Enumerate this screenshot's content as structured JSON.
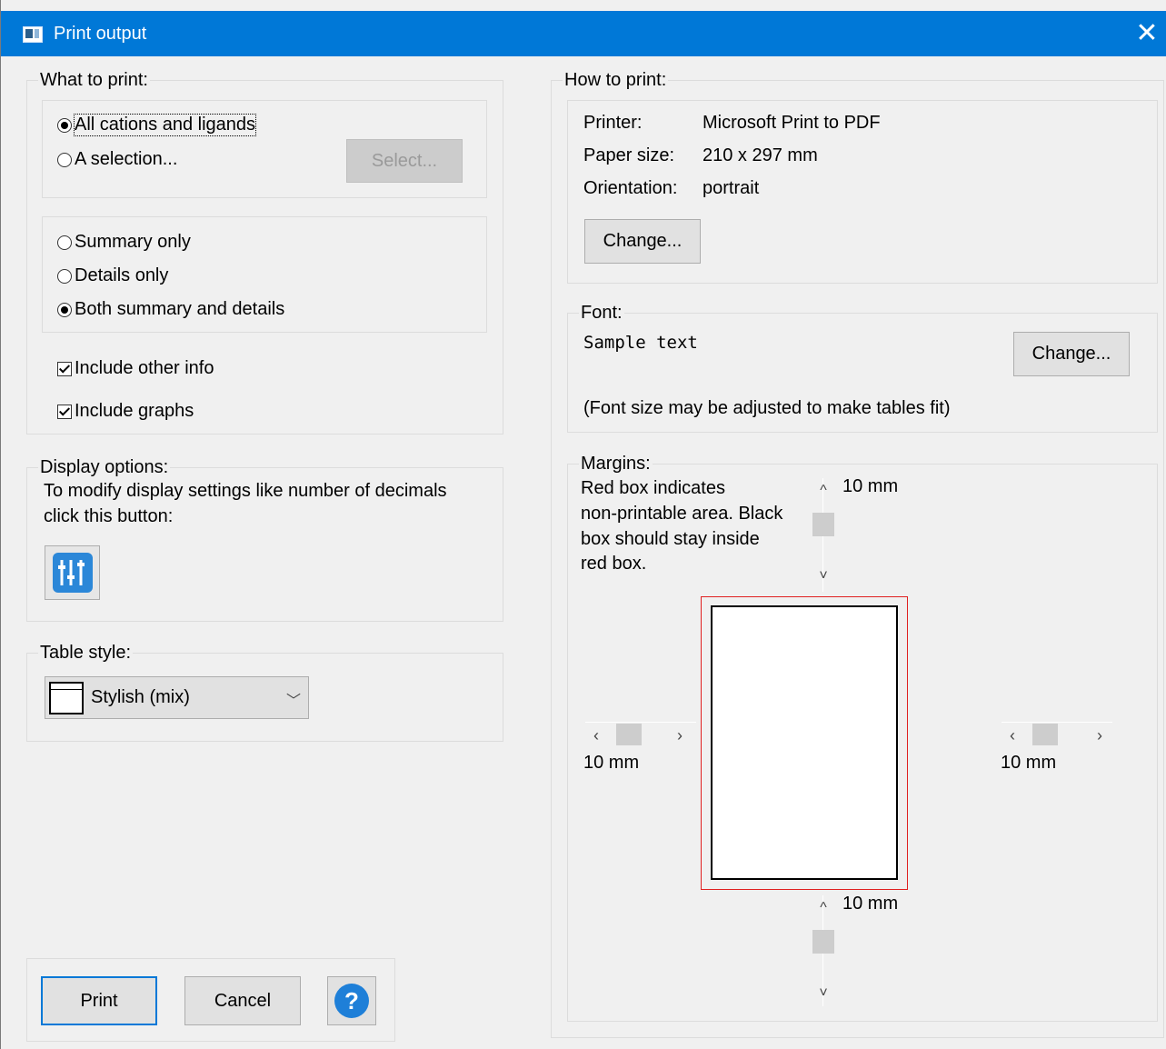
{
  "window": {
    "title": "Print output"
  },
  "what_to_print": {
    "legend": "What to print:",
    "all_label": "All cations and ligands",
    "selection_label": "A selection...",
    "select_button": "Select...",
    "summary_label": "Summary only",
    "details_label": "Details only",
    "both_label": "Both summary and details",
    "other_info_label": "Include other info",
    "graphs_label": "Include graphs"
  },
  "display_options": {
    "legend": "Display options:",
    "line1": "To modify display settings like number of decimals",
    "line2": "click this button:"
  },
  "table_style": {
    "legend": "Table style:",
    "selected": "Stylish (mix)"
  },
  "how_to_print": {
    "legend": "How to print:",
    "printer_label": "Printer:",
    "printer_value": "Microsoft Print to PDF",
    "paper_label": "Paper size:",
    "paper_value": "210 x 297 mm",
    "orientation_label": "Orientation:",
    "orientation_value": "portrait",
    "change_button": "Change..."
  },
  "font": {
    "legend": "Font:",
    "sample": "Sample text",
    "change_button": "Change...",
    "note": "(Font size may be adjusted to make tables fit)"
  },
  "margins": {
    "legend": "Margins:",
    "desc1": "Red box indicates",
    "desc2": "non-printable area. Black",
    "desc3": "box should stay inside",
    "desc4": "red box.",
    "top": "10 mm",
    "left": "10 mm",
    "right": "10 mm",
    "bottom": "10 mm"
  },
  "footer": {
    "print_button": "Print",
    "cancel_button": "Cancel",
    "help_icon": "?"
  },
  "colors": {
    "accent": "#0078d7",
    "non_printable_box": "#e02020",
    "help": "#1e7fd8",
    "settings_icon": "#2b87d8"
  }
}
